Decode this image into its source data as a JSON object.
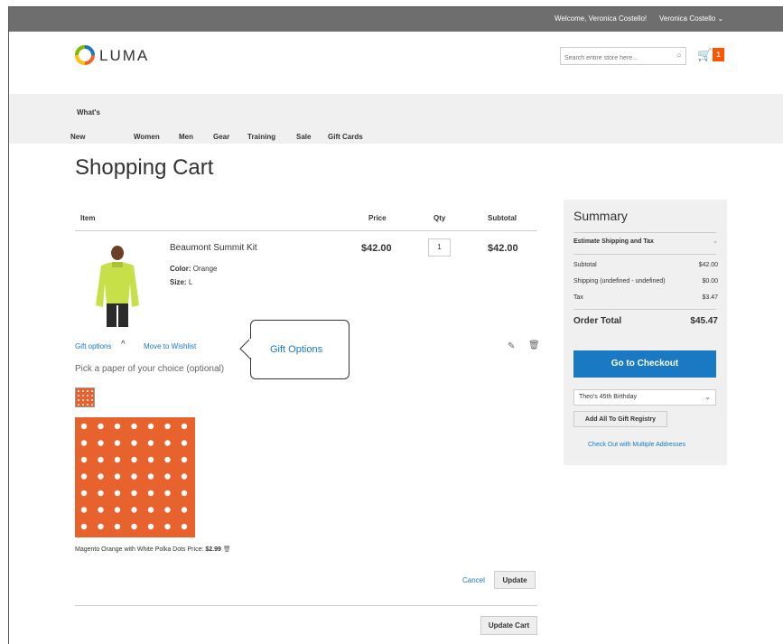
{
  "header": {
    "welcome": "Welcome, Veronica Costello!",
    "account_name": "Veronica Costello",
    "logo_text": "LUMA",
    "search_placeholder": "Search entire store here...",
    "cart_count": "1"
  },
  "nav": {
    "items": [
      "What's New",
      "Women",
      "Men",
      "Gear",
      "Training",
      "Sale",
      "Gift Cards"
    ]
  },
  "page": {
    "title": "Shopping Cart"
  },
  "cart": {
    "columns": [
      "Item",
      "Price",
      "Qty",
      "Subtotal"
    ],
    "item": {
      "name": "Beaumont Summit Kit",
      "color_label": "Color:",
      "color_value": "Orange",
      "size_label": "Size:",
      "size_value": "L",
      "price": "$42.00",
      "qty": "1",
      "subtotal": "$42.00"
    },
    "gift_options_link": "Gift options",
    "move_to_wishlist": "Move to Wishlist",
    "callout": "Gift Options",
    "pick_paper": "Pick a paper of your choice (optional)",
    "paper_name": "Magento Orange with White Polka Dots",
    "paper_price_label": "Price:",
    "paper_price": "$2.99",
    "cancel": "Cancel",
    "update": "Update",
    "update_cart": "Update Cart"
  },
  "summary": {
    "title": "Summary",
    "estimate": "Estimate Shipping and Tax",
    "subtotal_label": "Subtotal",
    "subtotal": "$42.00",
    "shipping_label": "Shipping (undefined - undefined)",
    "shipping": "$0.00",
    "tax_label": "Tax",
    "tax": "$3.47",
    "order_total_label": "Order Total",
    "order_total": "$45.47",
    "checkout": "Go to Checkout",
    "registry": "Theo's 45th Birthday",
    "add_registry": "Add All To Gift Registry",
    "multi_address": "Check Out with Multiple Addresses"
  },
  "colors": {
    "accent": "#1979c3",
    "brand_orange": "#ff5501",
    "paper_orange": "#e8622e"
  }
}
